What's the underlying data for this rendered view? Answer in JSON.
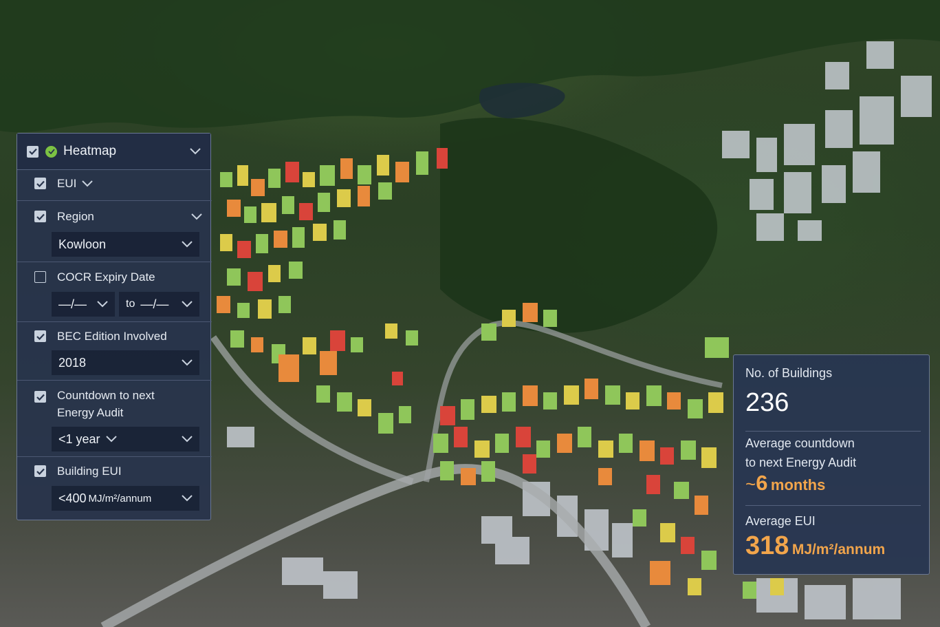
{
  "colors": {
    "panel_bg": "#28344c",
    "accent_orange": "#f2a54b",
    "status_green": "#7cc243",
    "heat_red": "#d9443a",
    "heat_orange": "#e88a3c",
    "heat_yellow": "#dccb4a",
    "heat_green": "#8fc65a"
  },
  "filter_panel": {
    "heatmap_label": "Heatmap",
    "eui_label": "EUI",
    "region": {
      "label": "Region",
      "value": "Kowloon"
    },
    "cocr": {
      "label": "COCR Expiry Date",
      "from_value": "—/—",
      "to_label": "to",
      "to_value": "—/—"
    },
    "bec": {
      "label": "BEC Edition Involved",
      "value": "2018"
    },
    "countdown": {
      "label_line1": "Countdown to next",
      "label_line2": "Energy Audit",
      "value": "<1 year"
    },
    "building_eui": {
      "label": "Building EUI",
      "value": "<400",
      "unit": "MJ/m²/annum"
    }
  },
  "stats_panel": {
    "buildings_label": "No. of Buildings",
    "buildings_value": "236",
    "countdown_label_line1": "Average countdown",
    "countdown_label_line2": "to next Energy Audit",
    "countdown_prefix": "~",
    "countdown_value": "6",
    "countdown_unit": "months",
    "eui_label": "Average EUI",
    "eui_value": "318",
    "eui_unit": "MJ/m²/annum"
  }
}
